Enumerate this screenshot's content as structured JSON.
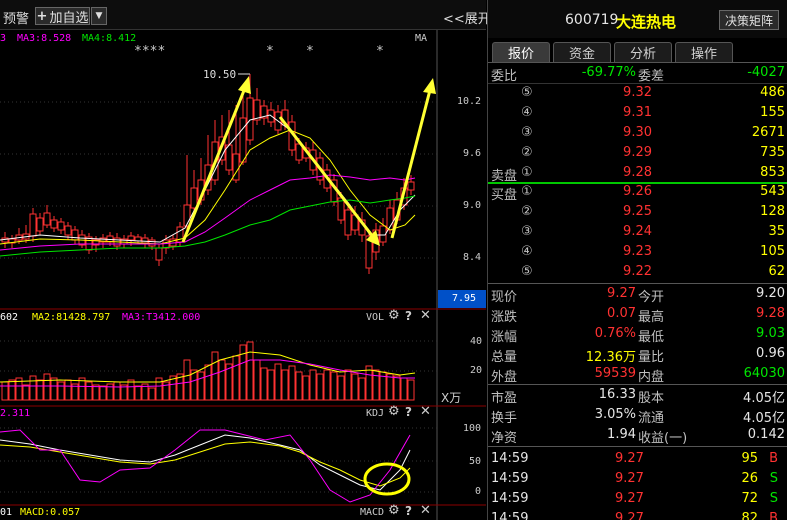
{
  "toolbar": {
    "alert_label": "预警",
    "add_watch_label": "加自选",
    "expand_label": "展开"
  },
  "main_chart": {
    "ma_partial": "3",
    "ma3_label": "MA3:8.528",
    "ma4_label": "MA4:8.412",
    "ma_tag": "MA",
    "high_marker": "10.50",
    "y_ticks": [
      "10.2",
      "9.6",
      "9.0",
      "8.4"
    ],
    "current_price_tag": "7.95",
    "stars": [
      "****",
      "*",
      "*",
      "*"
    ]
  },
  "volume_chart": {
    "ma1_partial": "602",
    "ma2_label": "MA2:81428.797",
    "ma3_label": "MA3:T3412.000",
    "tag": "VOL",
    "y_ticks": [
      "40",
      "20"
    ],
    "unit": "X万"
  },
  "kdj_chart": {
    "partial_label": "2.311",
    "tag": "KDJ",
    "y_ticks": [
      "100",
      "50",
      "0"
    ]
  },
  "macd_chart": {
    "partial_label": "01",
    "macd_label": "MACD:0.057",
    "tag": "MACD"
  },
  "header": {
    "code": "600719",
    "name": "大连热电",
    "decision_button": "决策矩阵"
  },
  "tabs": [
    "报价",
    "资金",
    "分析",
    "操作"
  ],
  "order_book": {
    "weibi_label": "委比",
    "weibi_value": "-69.77%",
    "weicha_label": "委差",
    "weicha_value": "-4027",
    "sell_label": "卖盘",
    "buy_label": "买盘",
    "asks": [
      {
        "level": "⑤",
        "price": "9.32",
        "volume": "486"
      },
      {
        "level": "④",
        "price": "9.31",
        "volume": "155"
      },
      {
        "level": "③",
        "price": "9.30",
        "volume": "2671"
      },
      {
        "level": "②",
        "price": "9.29",
        "volume": "735"
      },
      {
        "level": "①",
        "price": "9.28",
        "volume": "853"
      }
    ],
    "bids": [
      {
        "level": "①",
        "price": "9.26",
        "volume": "543"
      },
      {
        "level": "②",
        "price": "9.25",
        "volume": "128"
      },
      {
        "level": "③",
        "price": "9.24",
        "volume": "35"
      },
      {
        "level": "④",
        "price": "9.23",
        "volume": "105"
      },
      {
        "level": "⑤",
        "price": "9.22",
        "volume": "62"
      }
    ]
  },
  "quote": [
    {
      "l1": "现价",
      "v1": "9.27",
      "c1": "red",
      "l2": "今开",
      "v2": "9.20",
      "c2": "white"
    },
    {
      "l1": "涨跌",
      "v1": "0.07",
      "c1": "red",
      "l2": "最高",
      "v2": "9.28",
      "c2": "red"
    },
    {
      "l1": "涨幅",
      "v1": "0.76%",
      "c1": "red",
      "l2": "最低",
      "v2": "9.03",
      "c2": "green"
    },
    {
      "l1": "总量",
      "v1": "12.36万",
      "c1": "yellow",
      "l2": "量比",
      "v2": "0.96",
      "c2": "white"
    },
    {
      "l1": "外盘",
      "v1": "59539",
      "c1": "red",
      "l2": "内盘",
      "v2": "64030",
      "c2": "green"
    }
  ],
  "fundamentals": [
    {
      "l1": "市盈",
      "v1": "16.33",
      "l2": "股本",
      "v2": "4.05亿"
    },
    {
      "l1": "换手",
      "v1": "3.05%",
      "l2": "流通",
      "v2": "4.05亿"
    },
    {
      "l1": "净资",
      "v1": "1.94",
      "l2": "收益(一)",
      "v2": "0.142"
    }
  ],
  "ticks": [
    {
      "time": "14:59",
      "price": "9.27",
      "volume": "95",
      "side": "B"
    },
    {
      "time": "14:59",
      "price": "9.27",
      "volume": "26",
      "side": "S"
    },
    {
      "time": "14:59",
      "price": "9.27",
      "volume": "72",
      "side": "S"
    },
    {
      "time": "14:59",
      "price": "9.27",
      "volume": "82",
      "side": "B"
    }
  ],
  "colors": {
    "up": "#ff3232",
    "down": "#00e5ff",
    "ma_white": "#ffffff",
    "ma_yellow": "#ffff00",
    "ma_magenta": "#ff00ff",
    "ma_green": "#00e600",
    "arrow": "#ffff33"
  }
}
